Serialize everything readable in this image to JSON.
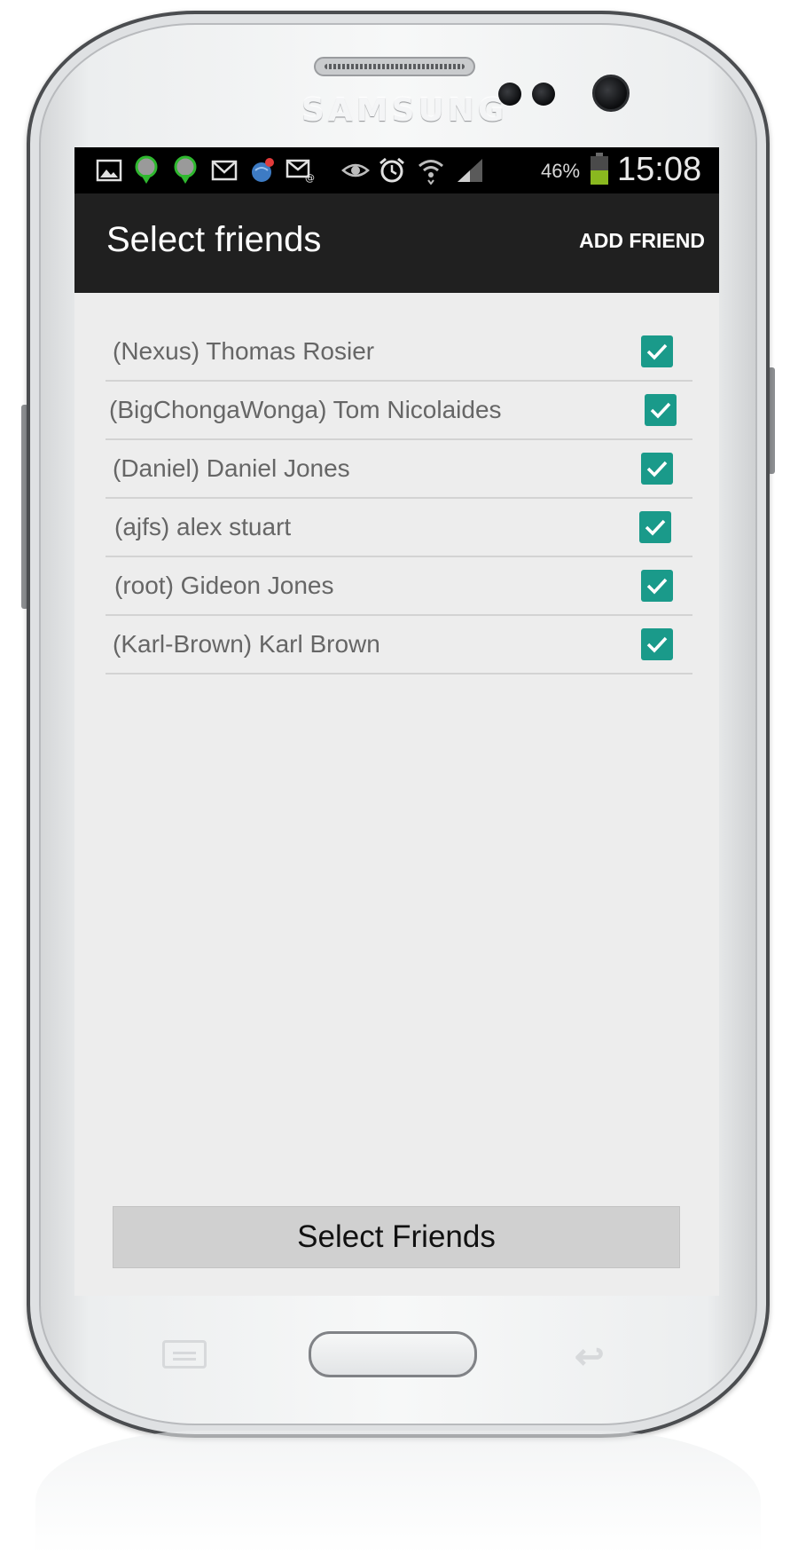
{
  "device": {
    "brand": "SAMSUNG"
  },
  "status_bar": {
    "icons": [
      "picture-icon",
      "location-pin-icon",
      "location-pin-icon",
      "gmail-icon",
      "globe-notification-icon",
      "email-icon",
      "eye-icon",
      "alarm-icon",
      "wifi-icon",
      "signal-icon",
      "battery-icon"
    ],
    "battery_percent": "46%",
    "time": "15:08"
  },
  "action_bar": {
    "title": "Select friends",
    "add_friend_label": "ADD FRIEND"
  },
  "friends": [
    {
      "label": "(Nexus) Thomas Rosier",
      "checked": true
    },
    {
      "label": "(BigChongaWonga) Tom Nicolaides",
      "checked": true
    },
    {
      "label": "(Daniel) Daniel Jones",
      "checked": true
    },
    {
      "label": "(ajfs) alex stuart",
      "checked": true
    },
    {
      "label": "(root) Gideon Jones",
      "checked": true
    },
    {
      "label": "(Karl-Brown) Karl Brown",
      "checked": true
    }
  ],
  "select_button_label": "Select Friends",
  "colors": {
    "checkbox": "#1a9a8a",
    "action_bar": "#202020",
    "screen_bg": "#ededed",
    "battery_fill": "#8ab81f"
  }
}
